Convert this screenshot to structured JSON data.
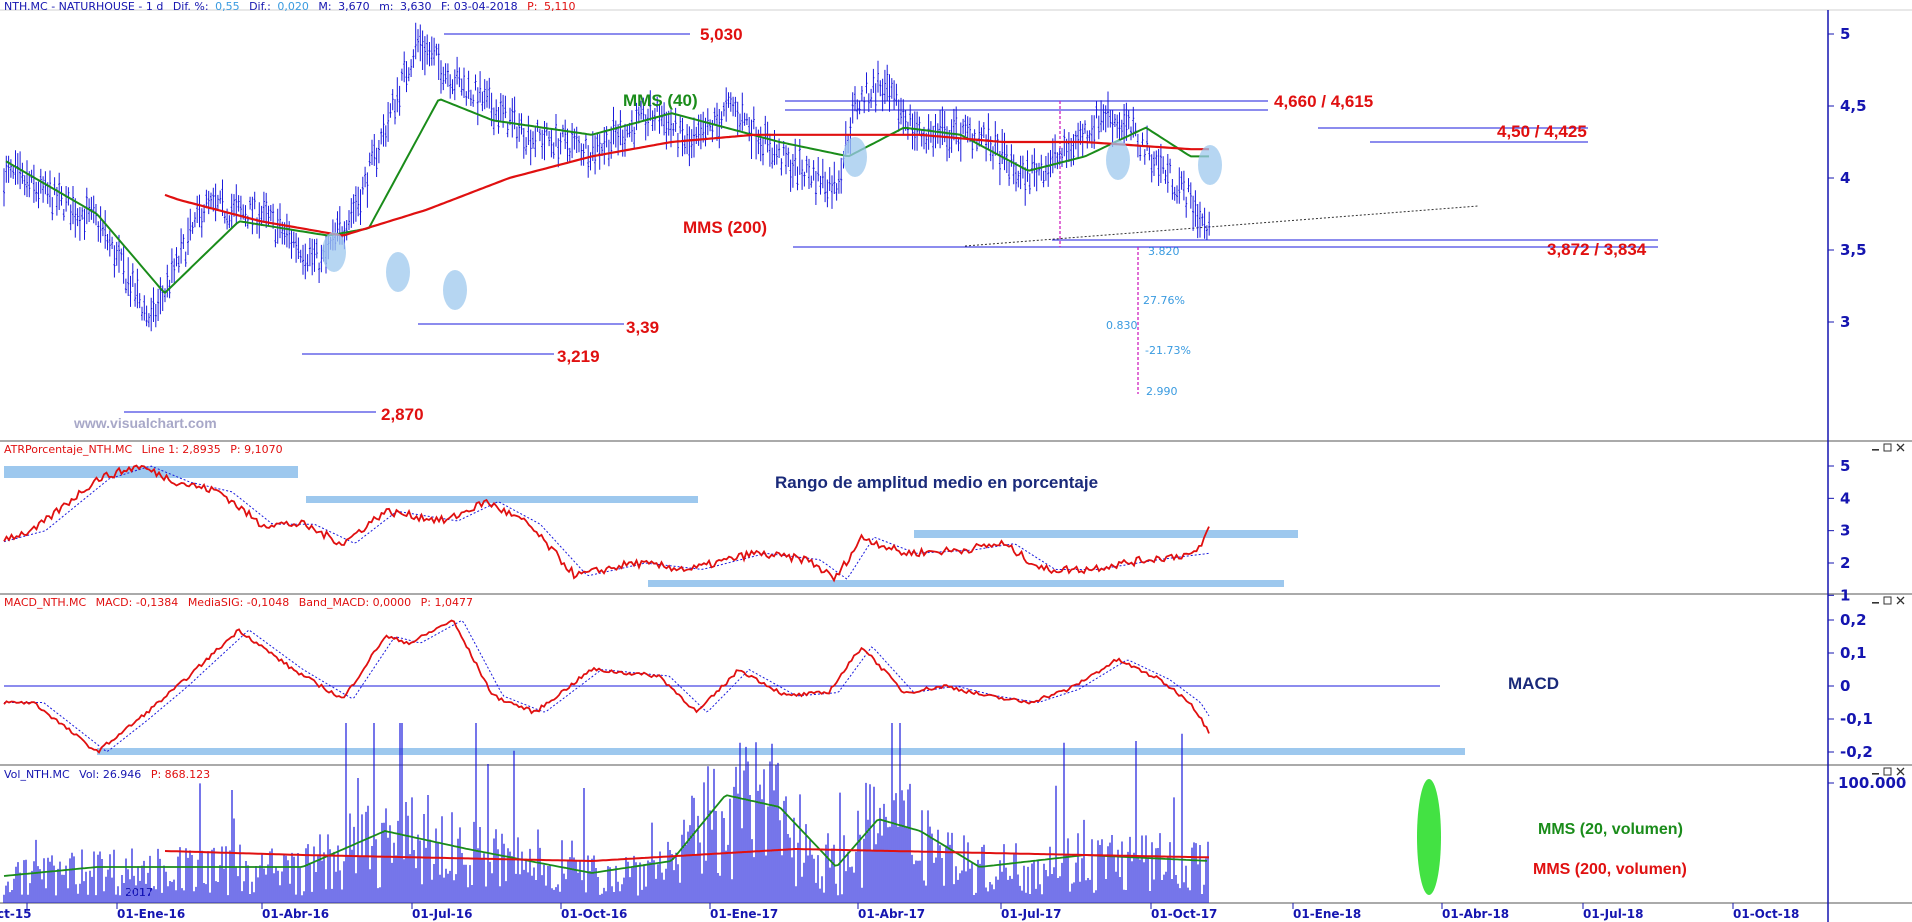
{
  "colors": {
    "price": "#1a1adc",
    "mms40": "#1a8c1a",
    "mms200": "#e01010",
    "annotation_red": "#e01010",
    "annotation_green": "#1a8c1a",
    "navy": "#1a2a7a",
    "highlight": "#9dc8ee",
    "axis": "#1515b0"
  },
  "panels": {
    "price": {
      "header": {
        "symbol": "NTH.MC - NATURHOUSE - 1 d",
        "dif_pct_label": "Dif. %:",
        "dif_pct": "0,55",
        "dif_label": "Dif.:",
        "dif": "0,020",
        "min_label": "M:",
        "min": "3,670",
        "max_label": "m:",
        "max": "3,630",
        "date_label": "F: 03-04-2018",
        "p_label": "P:",
        "p": "5,110"
      },
      "y_ticks": [
        "5",
        "4,5",
        "4",
        "3,5",
        "3"
      ],
      "watermark": "www.visualchart.com"
    },
    "atr": {
      "header_name": "ATRPorcentaje_NTH.MC",
      "header_line": "Line 1: 2,8935",
      "header_p": "P: 9,1070",
      "title": "Rango de amplitud medio en porcentaje",
      "y_ticks": [
        "5",
        "4",
        "3",
        "2",
        "1"
      ]
    },
    "macd": {
      "header_name": "MACD_NTH.MC",
      "header_macd": "MACD: -0,1384",
      "header_sig": "MediaSIG: -0,1048",
      "header_band": "Band_MACD: 0,0000",
      "header_p": "P: 1,0477",
      "title": "MACD",
      "y_ticks": [
        "0,2",
        "0,1",
        "0",
        "-0,1",
        "-0,2"
      ]
    },
    "vol": {
      "header_name": "Vol_NTH.MC",
      "header_vol": "Vol: 26.946",
      "header_p": "P: 868.123",
      "mms20_label": "MMS (20, volumen)",
      "mms200_label": "MMS (200, volumen)",
      "y_tick": "100.000",
      "year_label": "2017"
    }
  },
  "chart_data": {
    "type": "line",
    "title": "NTH.MC - NATURHOUSE - 1 d",
    "x_ticks": [
      "ct-15",
      "01-Ene-16",
      "01-Abr-16",
      "01-Jul-16",
      "01-Oct-16",
      "01-Ene-17",
      "01-Abr-17",
      "01-Jul-17",
      "01-Oct-17",
      "01-Ene-18",
      "01-Abr-18",
      "01-Jul-18",
      "01-Oct-18"
    ],
    "price_series": {
      "x": [
        "2015-10-01",
        "2015-11-01",
        "2016-01-01",
        "2016-02-10",
        "2016-03-20",
        "2016-05-01",
        "2016-06-15",
        "2016-07-15",
        "2016-08-25",
        "2016-09-20",
        "2016-11-15",
        "2017-01-01",
        "2017-02-20",
        "2017-03-15",
        "2017-04-15",
        "2017-05-25",
        "2017-07-01",
        "2017-07-15",
        "2017-08-01",
        "2017-09-01",
        "2017-10-15",
        "2017-11-15",
        "2017-12-15",
        "2018-01-15",
        "2018-02-01",
        "2018-03-01",
        "2018-03-20",
        "2018-04-03"
      ],
      "close": [
        4.1,
        4.0,
        3.7,
        3.0,
        3.8,
        3.75,
        3.4,
        3.9,
        4.95,
        4.7,
        4.3,
        4.2,
        4.45,
        4.2,
        4.5,
        4.1,
        3.95,
        4.5,
        4.65,
        4.3,
        4.3,
        4.0,
        4.15,
        4.45,
        4.35,
        4.05,
        3.85,
        3.6
      ]
    },
    "mms40": {
      "x": [
        "2015-10-01",
        "2016-01-01",
        "2016-02-20",
        "2016-04-15",
        "2016-06-20",
        "2016-07-20",
        "2016-09-10",
        "2016-10-20",
        "2017-01-01",
        "2017-03-01",
        "2017-04-10",
        "2017-05-20",
        "2017-07-10",
        "2017-08-20",
        "2017-10-01",
        "2017-11-20",
        "2018-01-01",
        "2018-02-15",
        "2018-03-20"
      ],
      "values": [
        4.25,
        3.75,
        3.2,
        3.7,
        3.6,
        3.65,
        4.55,
        4.4,
        4.3,
        4.45,
        4.35,
        4.25,
        4.15,
        4.35,
        4.3,
        4.05,
        4.15,
        4.35,
        4.15
      ]
    },
    "mms200": {
      "x": [
        "2016-01-01",
        "2016-03-01",
        "2016-05-01",
        "2016-07-01",
        "2016-09-01",
        "2016-11-01",
        "2017-01-01",
        "2017-03-01",
        "2017-05-01",
        "2017-07-01",
        "2017-09-01",
        "2017-11-01",
        "2018-01-01",
        "2018-03-20"
      ],
      "values": [
        4.05,
        3.85,
        3.7,
        3.6,
        3.78,
        4.0,
        4.15,
        4.25,
        4.3,
        4.3,
        4.3,
        4.25,
        4.25,
        4.2
      ]
    },
    "annotations": [
      {
        "label": "5,030",
        "value": 5.03
      },
      {
        "label": "4,660 / 4,615",
        "value": 4.66
      },
      {
        "label": "4,50 / 4,425",
        "value": 4.5
      },
      {
        "label": "3,872 / 3,834",
        "value": 3.87
      },
      {
        "label": "3,39",
        "value": 3.39
      },
      {
        "label": "3,219",
        "value": 3.219
      },
      {
        "label": "2,870",
        "value": 2.87
      },
      {
        "label": "MMS (40)",
        "series": "mms40"
      },
      {
        "label": "MMS (200)",
        "series": "mms200"
      }
    ],
    "fibo_measure": {
      "top": "3.820",
      "bottom": "2.990",
      "diff": "0.830",
      "pct_up": "27.76%",
      "pct_down": "-21.73%"
    },
    "price_ylim": [
      2.75,
      5.2
    ],
    "atr": {
      "x": [
        "2015-10-01",
        "2015-11-15",
        "2016-01-01",
        "2016-02-01",
        "2016-03-01",
        "2016-04-01",
        "2016-05-01",
        "2016-06-01",
        "2016-07-01",
        "2016-08-01",
        "2016-09-15",
        "2016-10-15",
        "2016-11-15",
        "2016-12-20",
        "2017-02-01",
        "2017-03-15",
        "2017-05-01",
        "2017-06-10",
        "2017-06-30",
        "2017-07-20",
        "2017-08-20",
        "2017-10-01",
        "2017-11-01",
        "2017-12-01",
        "2018-01-01",
        "2018-02-15",
        "2018-03-25",
        "2018-04-03"
      ],
      "values": [
        2.5,
        3.0,
        4.6,
        5.0,
        4.5,
        4.2,
        3.2,
        3.2,
        2.6,
        3.6,
        3.3,
        3.9,
        3.2,
        1.6,
        2.0,
        1.8,
        2.3,
        2.1,
        1.5,
        2.8,
        2.3,
        2.4,
        2.6,
        1.8,
        1.8,
        2.1,
        2.3,
        3.1
      ],
      "ylim": [
        0.9,
        5.3
      ]
    },
    "macd": {
      "x": [
        "2015-10-01",
        "2015-11-15",
        "2016-01-01",
        "2016-02-01",
        "2016-03-01",
        "2016-04-15",
        "2016-05-25",
        "2016-07-01",
        "2016-08-01",
        "2016-08-20",
        "2016-09-20",
        "2016-10-20",
        "2016-11-20",
        "2017-01-01",
        "2017-02-20",
        "2017-03-20",
        "2017-04-20",
        "2017-05-25",
        "2017-06-25",
        "2017-07-20",
        "2017-08-20",
        "2017-09-20",
        "2017-10-20",
        "2017-11-20",
        "2017-12-20",
        "2018-01-25",
        "2018-02-25",
        "2018-03-20",
        "2018-04-03"
      ],
      "values": [
        -0.05,
        -0.05,
        -0.2,
        -0.1,
        0.0,
        0.17,
        0.05,
        -0.04,
        0.15,
        0.13,
        0.2,
        -0.03,
        -0.08,
        0.05,
        0.03,
        -0.08,
        0.05,
        -0.03,
        -0.02,
        0.12,
        -0.02,
        0.0,
        -0.03,
        -0.05,
        -0.01,
        0.08,
        0.02,
        -0.05,
        -0.14
      ],
      "ylim": [
        -0.23,
        0.23
      ]
    },
    "volume": {
      "mms20_x": [
        "2015-10-01",
        "2016-01-01",
        "2016-06-01",
        "2016-08-01",
        "2016-10-01",
        "2017-01-01",
        "2017-03-01",
        "2017-04-10",
        "2017-05-20",
        "2017-07-01",
        "2017-08-01",
        "2017-09-01",
        "2017-10-15",
        "2018-01-01",
        "2018-04-03"
      ],
      "mms20_values": [
        20000,
        30000,
        30000,
        60000,
        45000,
        25000,
        35000,
        90000,
        80000,
        30000,
        70000,
        60000,
        30000,
        40000,
        35000
      ],
      "mms200_x": [
        "2016-01-01",
        "2016-06-01",
        "2017-01-01",
        "2017-06-01",
        "2018-01-01",
        "2018-04-03"
      ],
      "mms200_values": [
        45000,
        40000,
        35000,
        45000,
        40000,
        38000
      ],
      "ylim": [
        0,
        150000
      ]
    }
  }
}
